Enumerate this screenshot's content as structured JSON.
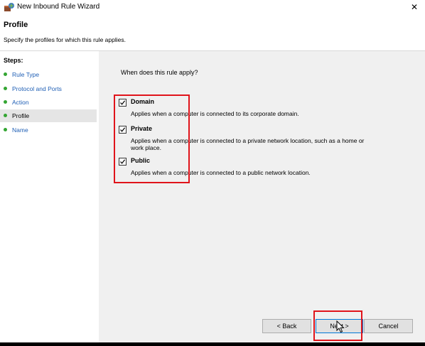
{
  "window": {
    "title": "New Inbound Rule Wizard",
    "close_glyph": "✕"
  },
  "header": {
    "title": "Profile",
    "subtitle": "Specify the profiles for which this rule applies."
  },
  "steps": {
    "heading": "Steps:",
    "items": [
      {
        "label": "Rule Type",
        "active": false
      },
      {
        "label": "Protocol and Ports",
        "active": false
      },
      {
        "label": "Action",
        "active": false
      },
      {
        "label": "Profile",
        "active": true
      },
      {
        "label": "Name",
        "active": false
      }
    ]
  },
  "main": {
    "question": "When does this rule apply?",
    "options": [
      {
        "label": "Domain",
        "checked": true,
        "description": "Applies when a computer is connected to its corporate domain."
      },
      {
        "label": "Private",
        "checked": true,
        "description": "Applies when a computer is connected to a private network location, such as a home or work place."
      },
      {
        "label": "Public",
        "checked": true,
        "description": "Applies when a computer is connected to a public network location."
      }
    ]
  },
  "footer": {
    "back_label": "< Back",
    "next_label": "Next >",
    "cancel_label": "Cancel"
  },
  "colors": {
    "highlight": "#e0141b",
    "step_dot": "#33a532",
    "step_link": "#1f5fb5",
    "panel_bg": "#f0f0f0"
  },
  "icons": {
    "app": "firewall-wizard-icon",
    "close": "close-icon",
    "step": "step-dot-icon",
    "cursor": "cursor-arrow-icon"
  }
}
